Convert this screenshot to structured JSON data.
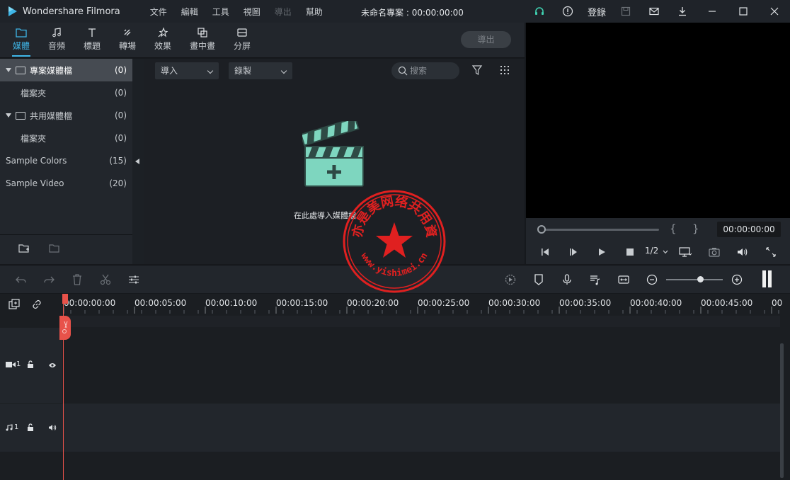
{
  "app": {
    "title": "Wondershare Filmora",
    "document_title": "未命名專案 : 00:00:00:00"
  },
  "menu": [
    "文件",
    "編輯",
    "工具",
    "視圖",
    "導出",
    "幫助"
  ],
  "titlebar": {
    "login_label": "登錄"
  },
  "tabs": [
    {
      "label": "媒體",
      "icon": "folder-icon"
    },
    {
      "label": "音頻",
      "icon": "music-note-icon"
    },
    {
      "label": "標題",
      "icon": "text-icon"
    },
    {
      "label": "轉場",
      "icon": "transition-icon"
    },
    {
      "label": "效果",
      "icon": "effects-icon"
    },
    {
      "label": "畫中畫",
      "icon": "pip-icon"
    },
    {
      "label": "分屏",
      "icon": "split-screen-icon"
    }
  ],
  "export_label": "導出",
  "library": [
    {
      "label": "專案媒體檔",
      "count": "(0)"
    },
    {
      "label": "檔案夾",
      "count": "(0)"
    },
    {
      "label": "共用媒體檔",
      "count": "(0)"
    },
    {
      "label": "檔案夾",
      "count": "(0)"
    },
    {
      "label": "Sample Colors",
      "count": "(15)"
    },
    {
      "label": "Sample Video",
      "count": "(20)"
    }
  ],
  "media": {
    "import_label": "導入",
    "record_label": "錄製",
    "search_placeholder": "搜索",
    "drop_hint": "在此處導入媒體檔"
  },
  "preview": {
    "timecode": "00:00:00:00",
    "ratio": "1/2",
    "bracket_in": "{",
    "bracket_out": "}"
  },
  "timeline": {
    "ticks": [
      "00:00:00:00",
      "00:00:05:00",
      "00:00:10:00",
      "00:00:15:00",
      "00:00:20:00",
      "00:00:25:00",
      "00:00:30:00",
      "00:00:35:00",
      "00:00:40:00",
      "00:00:45:00",
      "00"
    ],
    "video_track": "1",
    "audio_track": "1"
  },
  "watermark": {
    "text": "www.yishimei.cn",
    "top_text": "亦是美网络共用資"
  },
  "colors": {
    "accent": "#3fb6e8",
    "playhead": "#e8524a",
    "panel": "#22262c",
    "stamp": "#e02020",
    "clapper": "#7ed6bf"
  }
}
